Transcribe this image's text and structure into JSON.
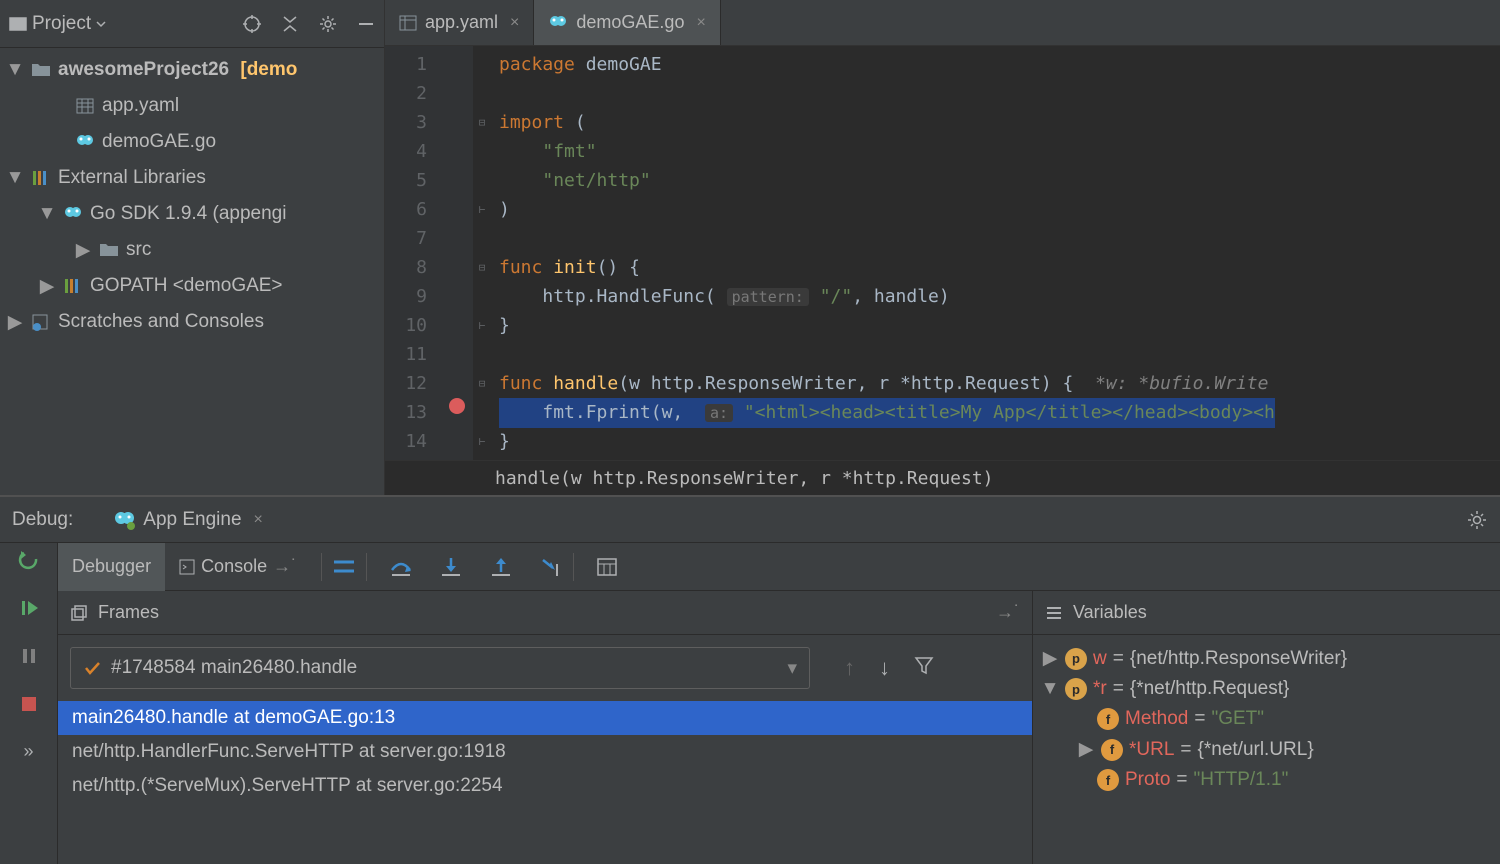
{
  "sidebar": {
    "title": "Project",
    "tree": {
      "root": "awesomeProject26",
      "root_suffix": "[demo",
      "app_yaml": "app.yaml",
      "demo_go": "demoGAE.go",
      "ext_libs": "External Libraries",
      "go_sdk": "Go SDK 1.9.4 (appengi",
      "src": "src",
      "gopath": "GOPATH <demoGAE>",
      "scratches": "Scratches and Consoles"
    }
  },
  "tabs": [
    {
      "label": "app.yaml"
    },
    {
      "label": "demoGAE.go"
    }
  ],
  "code": {
    "l1_kw": "package",
    "l1_pkg": "demoGAE",
    "l3_kw": "import",
    "l3_paren": "(",
    "l4_str": "\"fmt\"",
    "l5_str": "\"net/http\"",
    "l6": ")",
    "l8_kw": "func",
    "l8_fn": "init",
    "l8_rest": "() {",
    "l9_a": "http.HandleFunc(",
    "l9_hint": "pattern:",
    "l9_str": "\"/\"",
    "l9_b": ", handle)",
    "l10": "}",
    "l12_kw": "func",
    "l12_fn": "handle",
    "l12_sig": "(w http.ResponseWriter, r *http.Request) {",
    "l12_hint": "*w: *bufio.Write",
    "l13_a": "fmt.Fprint(w,",
    "l13_hint": "a:",
    "l13_str": "\"<html><head><title>My App</title></head><body><h",
    "l14": "}"
  },
  "breadcrumb": "handle(w http.ResponseWriter, r *http.Request)",
  "debug": {
    "label": "Debug:",
    "tab": "App Engine",
    "debugger_tab": "Debugger",
    "console_tab": "Console",
    "frames_label": "Frames",
    "vars_label": "Variables",
    "thread": "#1748584 main26480.handle",
    "frames": [
      "main26480.handle at demoGAE.go:13",
      "net/http.HandlerFunc.ServeHTTP at server.go:1918",
      "net/http.(*ServeMux).ServeHTTP at server.go:2254"
    ],
    "vars": {
      "w_name": "w",
      "w_val": "{net/http.ResponseWriter}",
      "r_name": "*r",
      "r_val": "{*net/http.Request}",
      "method_name": "Method",
      "method_val": "\"GET\"",
      "url_name": "*URL",
      "url_val": "{*net/url.URL}",
      "proto_name": "Proto",
      "proto_val": "\"HTTP/1.1\""
    }
  }
}
